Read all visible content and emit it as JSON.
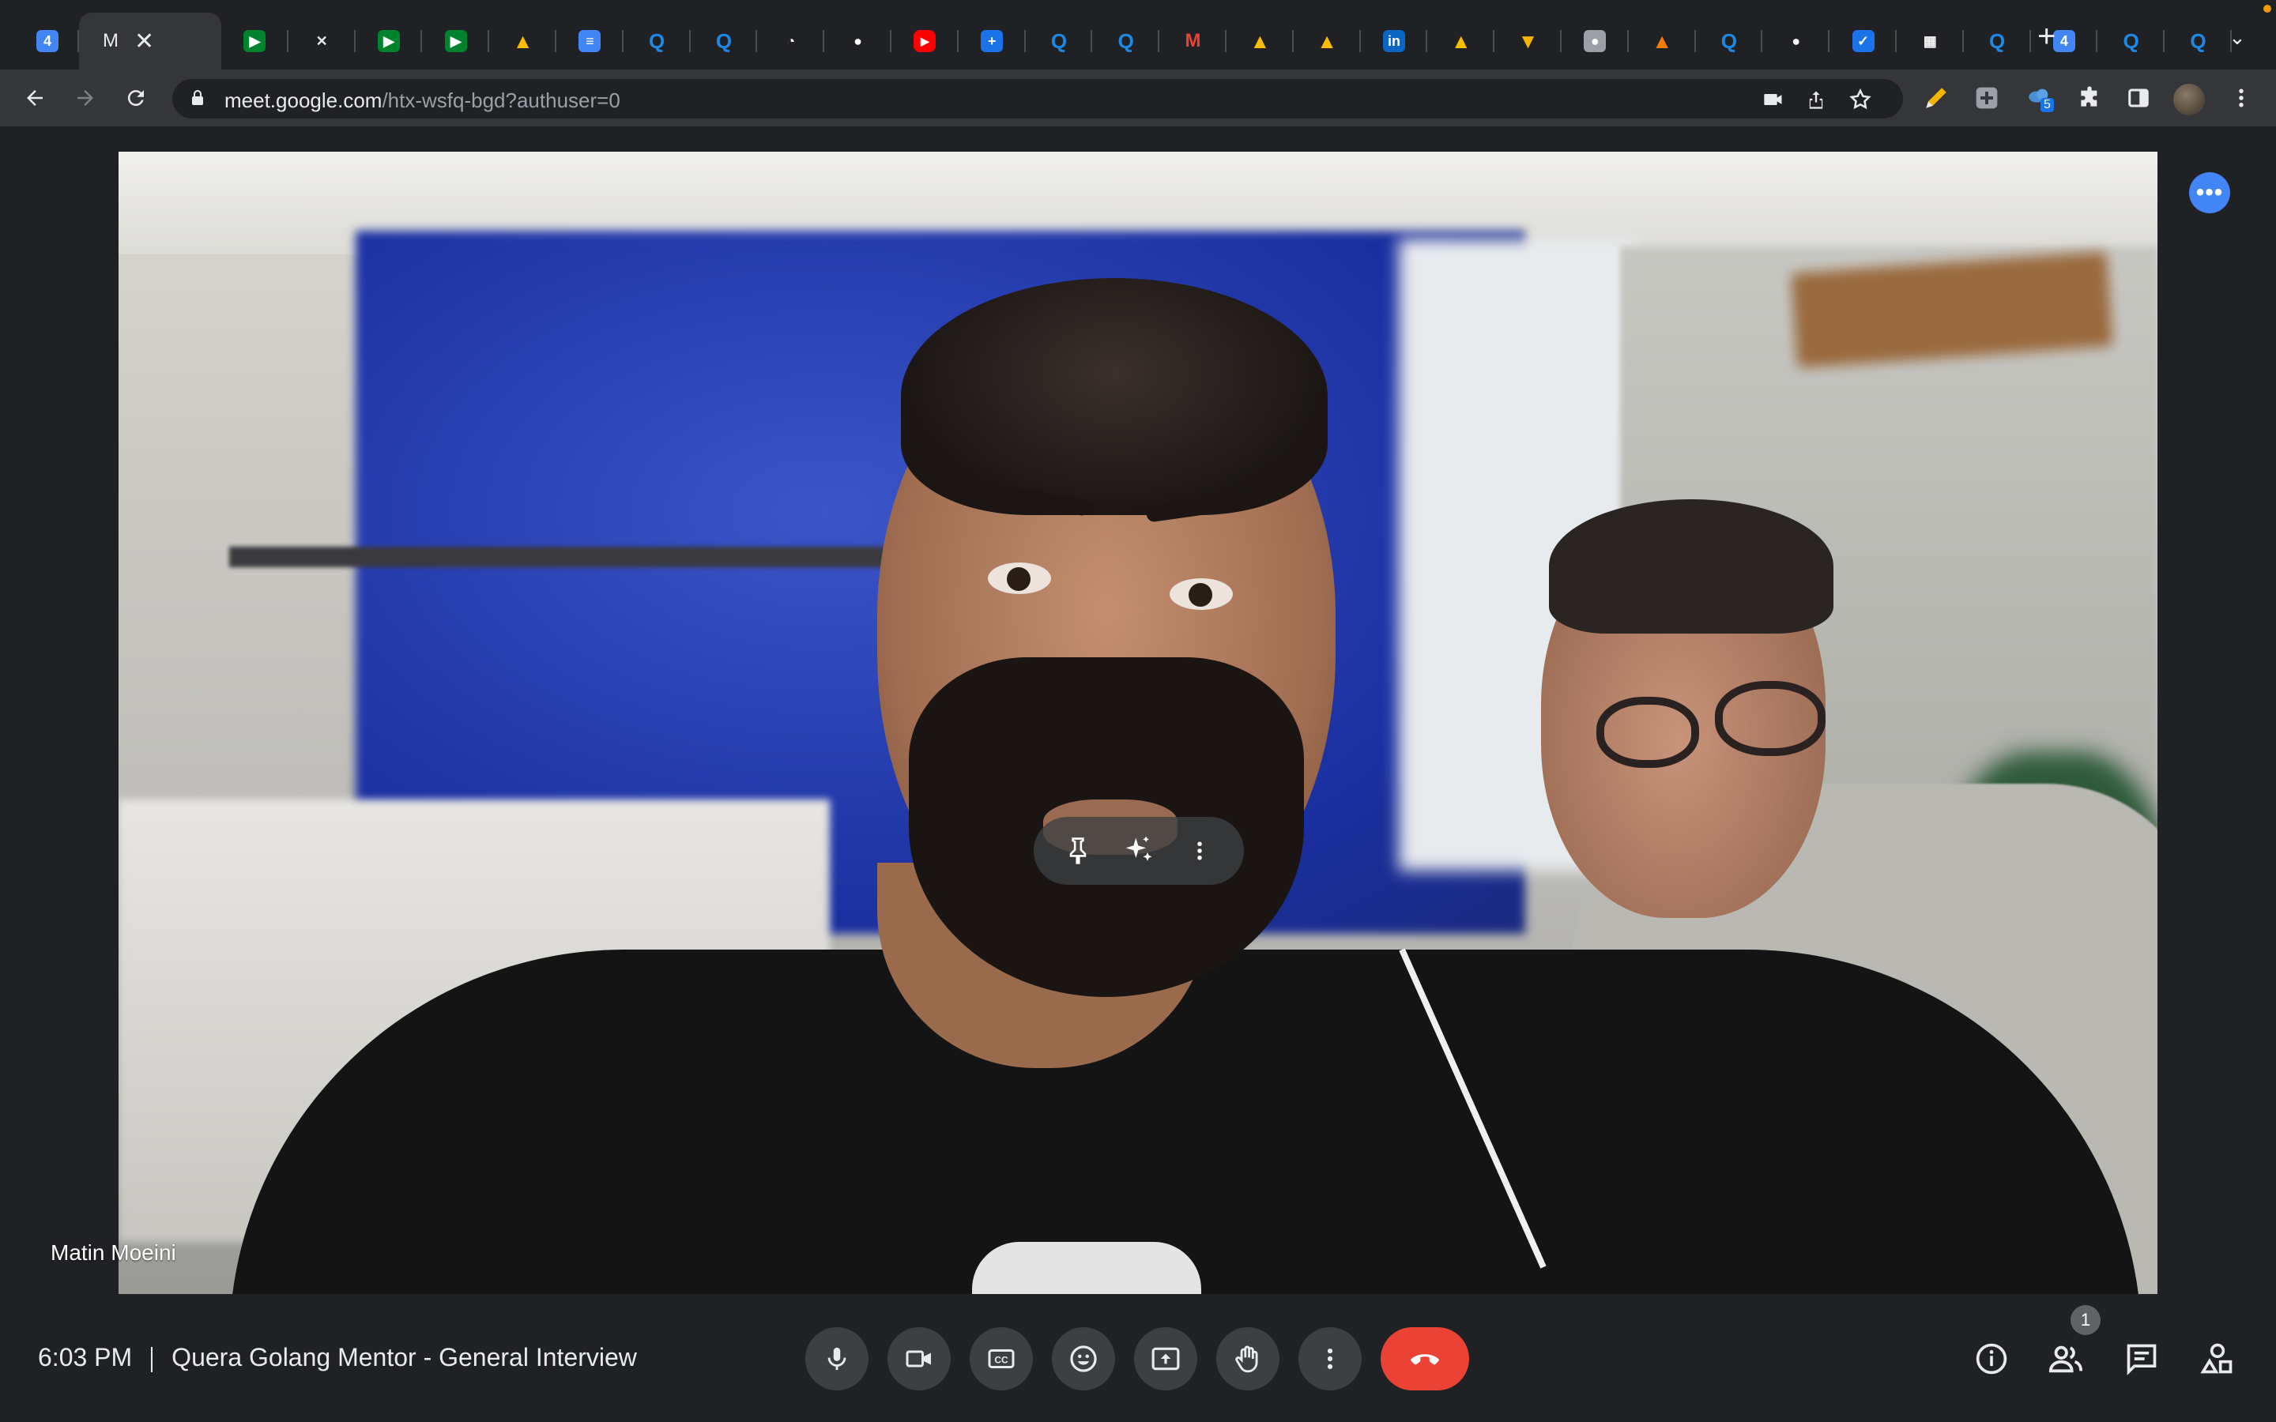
{
  "browser": {
    "active_tab": {
      "title": "M",
      "close_glyph": "✕"
    },
    "tabs": [
      {
        "icon": "google-calendar-icon",
        "glyph": "4",
        "color": "#4285f4"
      },
      {
        "icon": "google-meet-icon",
        "glyph": "▶",
        "color": "#00832d"
      },
      {
        "icon": "crossed-lines-icon",
        "glyph": "✕",
        "color": "#202124"
      },
      {
        "icon": "google-meet-icon",
        "glyph": "▶",
        "color": "#00832d"
      },
      {
        "icon": "google-meet-icon",
        "glyph": "▶",
        "color": "#00832d"
      },
      {
        "icon": "google-drive-icon",
        "glyph": "▲",
        "color": "#fbbc04"
      },
      {
        "icon": "google-docs-icon",
        "glyph": "≡",
        "color": "#4285f4"
      },
      {
        "icon": "quera-icon",
        "glyph": "Q",
        "color": "#1e88e5"
      },
      {
        "icon": "quera-icon",
        "glyph": "Q",
        "color": "#1e88e5"
      },
      {
        "icon": "clock-icon",
        "glyph": "◔",
        "color": "#ffffff"
      },
      {
        "icon": "github-icon",
        "glyph": "●",
        "color": "#ffffff"
      },
      {
        "icon": "youtube-icon",
        "glyph": "▶",
        "color": "#ff0000"
      },
      {
        "icon": "plus-square-icon",
        "glyph": "+",
        "color": "#1a73e8"
      },
      {
        "icon": "quera-icon",
        "glyph": "Q",
        "color": "#1e88e5"
      },
      {
        "icon": "quera-icon",
        "glyph": "Q",
        "color": "#1e88e5"
      },
      {
        "icon": "gmail-icon",
        "glyph": "M",
        "color": "#ea4335"
      },
      {
        "icon": "google-drive-icon",
        "glyph": "▲",
        "color": "#fbbc04"
      },
      {
        "icon": "google-drive-icon",
        "glyph": "▲",
        "color": "#fbbc04"
      },
      {
        "icon": "linkedin-icon",
        "glyph": "in",
        "color": "#0a66c2"
      },
      {
        "icon": "google-drive-icon",
        "glyph": "▲",
        "color": "#fbbc04"
      },
      {
        "icon": "cup-icon",
        "glyph": "▼",
        "color": "#f5b400"
      },
      {
        "icon": "globe-icon",
        "glyph": "●",
        "color": "#9aa0a6"
      },
      {
        "icon": "traffic-cone-icon",
        "glyph": "▲",
        "color": "#f57c00"
      },
      {
        "icon": "quera-icon",
        "glyph": "Q",
        "color": "#1e88e5"
      },
      {
        "icon": "globe-pin-icon",
        "glyph": "●",
        "color": "#ffffff"
      },
      {
        "icon": "check-badge-icon",
        "glyph": "✓",
        "color": "#1a73e8"
      },
      {
        "icon": "grid-page-icon",
        "glyph": "▦",
        "color": "#ffffff"
      },
      {
        "icon": "quera-icon",
        "glyph": "Q",
        "color": "#1e88e5"
      },
      {
        "icon": "google-calendar-icon",
        "glyph": "4",
        "color": "#4285f4"
      },
      {
        "icon": "quera-icon",
        "glyph": "Q",
        "color": "#1e88e5"
      },
      {
        "icon": "quera-icon",
        "glyph": "Q",
        "color": "#1e88e5"
      }
    ],
    "new_tab_glyph": "+",
    "tab_menu_glyph": "⌄",
    "url_host": "meet.google.com",
    "url_path": "/htx-wsfq-bgd?authuser=0",
    "extension_badge": "5"
  },
  "meet": {
    "participant_name": "Matin Moeini",
    "time": "6:03 PM",
    "meeting_title": "Quera Golang Mentor - General Interview",
    "participants_count": "1",
    "colors": {
      "background": "#202124",
      "control": "#3c4043",
      "end_call": "#ea4335",
      "accent": "#4285f4"
    }
  }
}
